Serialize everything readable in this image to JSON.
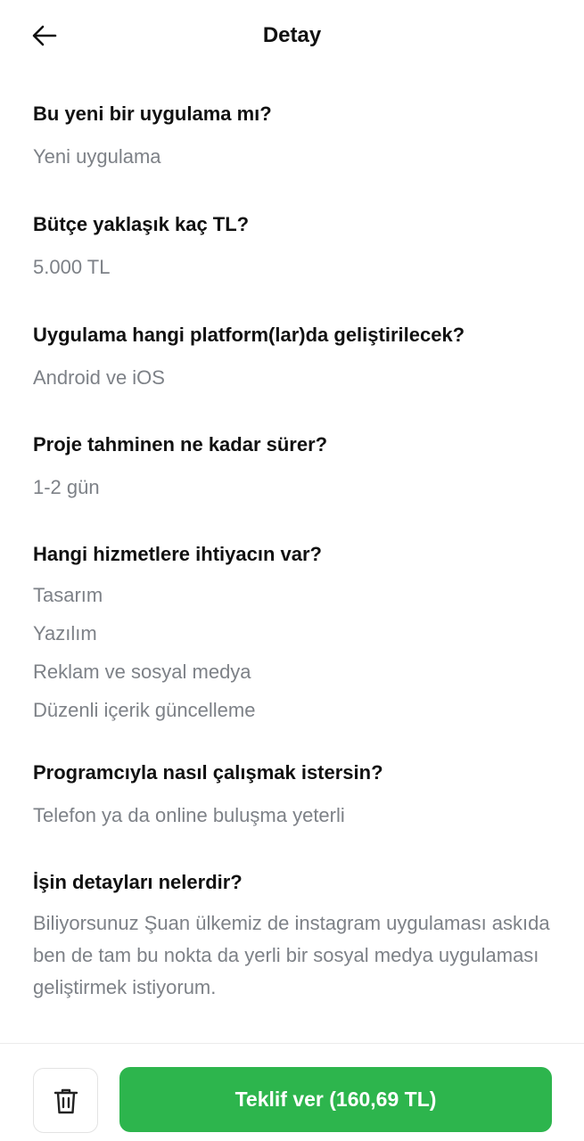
{
  "header": {
    "title": "Detay",
    "back_icon": "arrow-left-icon"
  },
  "sections": [
    {
      "question": "Bu yeni bir uygulama mı?",
      "answer": "Yeni uygulama"
    },
    {
      "question": "Bütçe yaklaşık kaç TL?",
      "answer": "5.000 TL"
    },
    {
      "question": "Uygulama hangi platform(lar)da geliştirilecek?",
      "answer": "Android ve iOS"
    },
    {
      "question": "Proje tahminen ne kadar sürer?",
      "answer": "1-2 gün"
    },
    {
      "question": "Hangi hizmetlere ihtiyacın var?",
      "answers": [
        "Tasarım",
        "Yazılım",
        "Reklam ve sosyal medya",
        "Düzenli içerik güncelleme"
      ]
    },
    {
      "question": "Programcıyla nasıl çalışmak istersin?",
      "answer": "Telefon ya da online buluşma yeterli"
    },
    {
      "question": "İşin detayları nelerdir?",
      "answer": "Biliyorsunuz Şuan ülkemiz de instagram uygulaması askıda ben de tam bu nokta da yerli bir sosyal medya uygulaması geliştirmek istiyorum."
    }
  ],
  "footer": {
    "delete_icon": "trash-icon",
    "offer_label": "Teklif ver (160,69 TL)"
  },
  "colors": {
    "primary_button": "#2db54d",
    "answer_text": "#7d8187",
    "question_text": "#111111"
  }
}
